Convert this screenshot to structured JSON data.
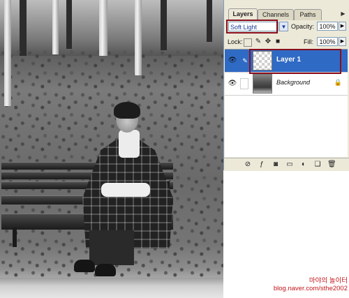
{
  "palette": {
    "tabs": [
      "Layers",
      "Channels",
      "Paths"
    ],
    "blend_mode": "Soft Light",
    "opacity_label": "Opacity:",
    "opacity_value": "100%",
    "lock_label": "Lock:",
    "fill_label": "Fill:",
    "fill_value": "100%",
    "layers": [
      {
        "name": "Layer 1",
        "selected": true,
        "visible": true
      },
      {
        "name": "Background",
        "selected": false,
        "visible": true,
        "locked": true
      }
    ],
    "footer_icons": [
      "link-layers-icon",
      "add-style-icon",
      "add-mask-icon",
      "new-group-icon",
      "adjustment-layer-icon",
      "new-layer-icon",
      "trash-icon"
    ]
  },
  "caption": {
    "title": "마야의 놀이터",
    "url": "blog.naver.com/sthe2002"
  },
  "colors": {
    "highlight_box": "#8a0e1e",
    "selected_row": "#2f6ac4",
    "caption": "#c4161c"
  }
}
